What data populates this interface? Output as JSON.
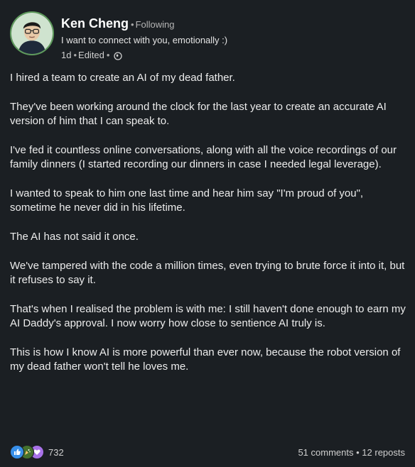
{
  "author": {
    "name": "Ken Cheng",
    "connection": "Following",
    "headline": "I want to connect with you, emotionally :)",
    "time": "1d",
    "edited": "Edited"
  },
  "post": {
    "paragraphs": [
      "I hired a team to create an AI of my dead father.",
      "They've been working around the clock for the last year to create an accurate AI version of him that I can speak to.",
      "I've fed it countless online conversations, along with all the voice recordings of our family dinners (I started recording our dinners in case I needed legal leverage).",
      "I wanted to speak to him one last time and hear him say \"I'm proud of you\", sometime he never did in his lifetime.",
      "The AI has not said it once.",
      "We've tampered with the code a million times, even trying to brute force it into it, but it refuses to say it.",
      "That's when I realised the problem is with me: I still haven't done enough to earn my AI Daddy's approval. I now worry how close to sentience AI truly is.",
      "This is how I know AI is more powerful than ever now, because the robot version of my dead father won't tell he loves me."
    ]
  },
  "footer": {
    "reaction_icons": [
      "like-icon",
      "celebrate-icon",
      "support-icon"
    ],
    "reaction_count": "732",
    "comments": "51 comments",
    "reposts": "12 reposts"
  },
  "colors": {
    "background": "#1b1f23",
    "like": "#378fe9",
    "celebrate": "#44712e",
    "support": "#a872e8"
  }
}
